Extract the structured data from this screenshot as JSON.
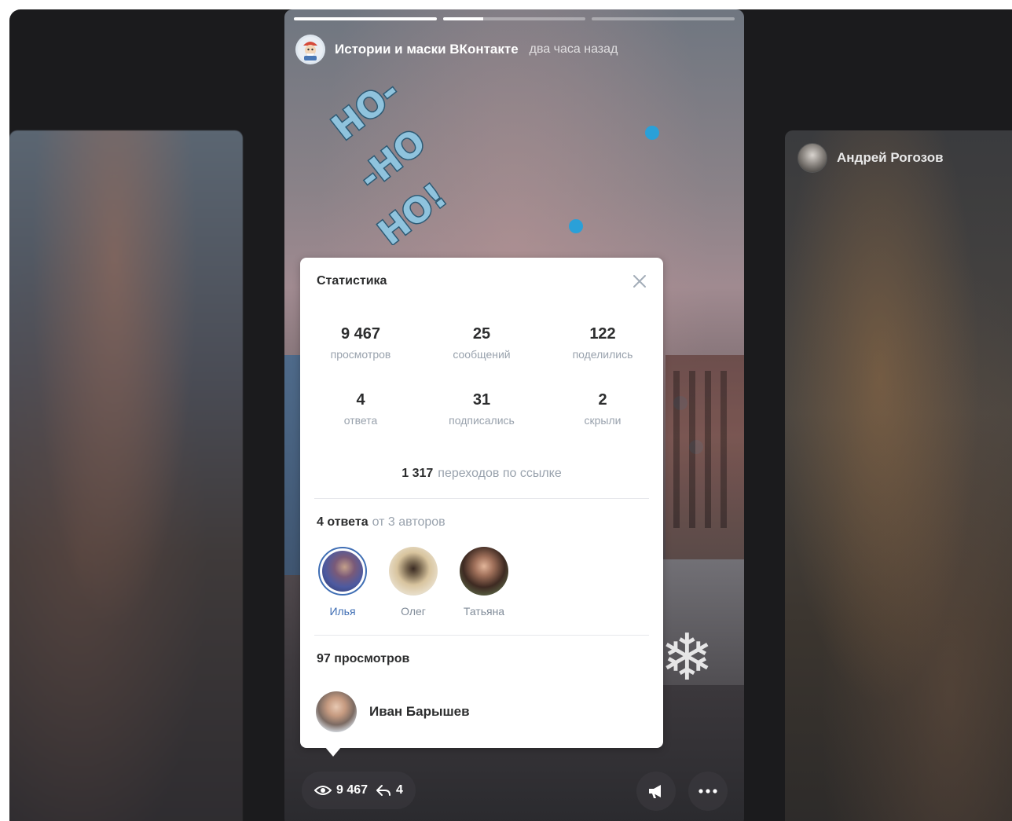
{
  "story": {
    "author": "Истории и маски ВКонтакте",
    "time": "два часа назад",
    "progress": [
      1.0,
      0.28,
      0.0
    ]
  },
  "side_right": {
    "author": "Андрей Рогозов"
  },
  "stats": {
    "title": "Статистика",
    "items": [
      {
        "value": "9 467",
        "label": "просмотров"
      },
      {
        "value": "25",
        "label": "сообщений"
      },
      {
        "value": "122",
        "label": "поделились"
      },
      {
        "value": "4",
        "label": "ответа"
      },
      {
        "value": "31",
        "label": "подписались"
      },
      {
        "value": "2",
        "label": "скрыли"
      }
    ],
    "clicks_value": "1 317",
    "clicks_label": "переходов по ссылке"
  },
  "replies": {
    "count": "4 ответа",
    "authors_text": "от 3 авторов",
    "authors": [
      {
        "name": "Илья",
        "active": true
      },
      {
        "name": "Олег",
        "active": false
      },
      {
        "name": "Татьяна",
        "active": false
      }
    ]
  },
  "views": {
    "heading": "97 просмотров",
    "viewers": [
      {
        "name": "Иван Барышев"
      }
    ]
  },
  "bottom": {
    "views": "9 467",
    "replies": "4"
  },
  "colors": {
    "accent": "#3f6eb4",
    "muted": "#99a2ad",
    "dot": "#2aa0d8"
  }
}
